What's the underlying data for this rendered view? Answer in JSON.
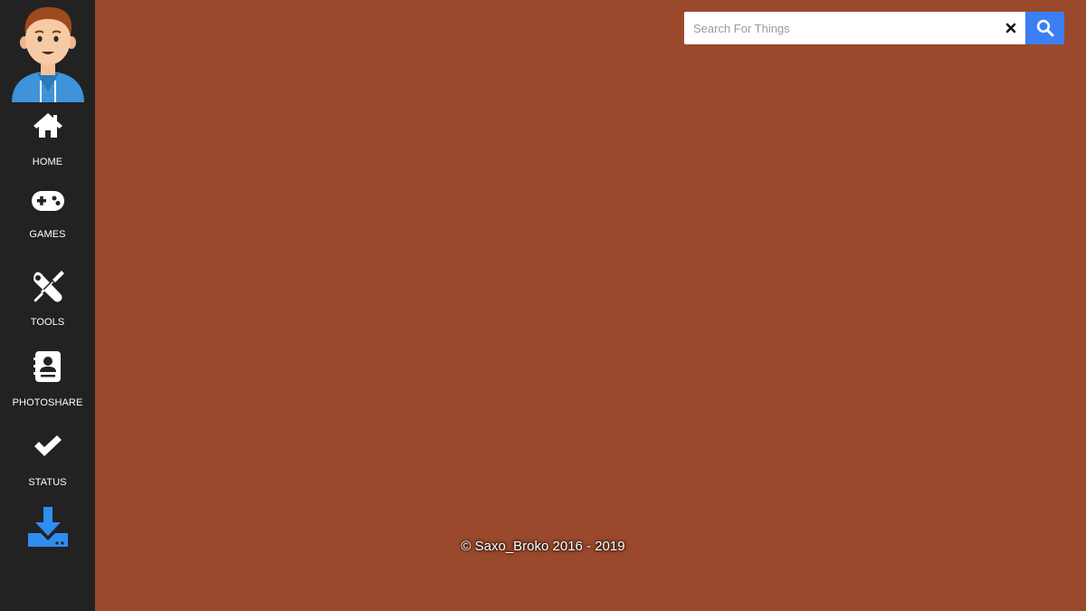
{
  "sidebar": {
    "avatar_icon": "user-avatar",
    "items": [
      {
        "label": "HOME",
        "icon": "home-icon"
      },
      {
        "label": "GAMES",
        "icon": "gamepad-icon"
      },
      {
        "label": "TOOLS",
        "icon": "tools-icon"
      },
      {
        "label": "PHOTOSHARE",
        "icon": "contact-card-icon"
      },
      {
        "label": "STATUS",
        "icon": "check-icon"
      },
      {
        "label": "",
        "icon": "download-icon"
      }
    ]
  },
  "search": {
    "value": "",
    "placeholder": "Search For Things",
    "clear_icon": "close-icon",
    "button_icon": "search-icon"
  },
  "footer": {
    "copyright": "© Saxo_Broko 2016 - 2019"
  },
  "colors": {
    "background": "#9a492c",
    "sidebar": "#222222",
    "accent": "#3b7ff2",
    "download_icon": "#2e8ef0"
  }
}
